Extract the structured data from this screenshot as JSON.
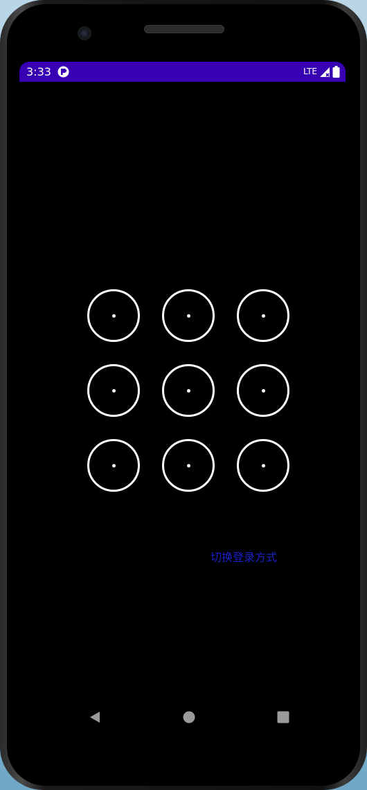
{
  "status_bar": {
    "time": "3:33",
    "network": "LTE",
    "notification_icon": "app-notification-icon",
    "signal_icon": "signal-icon",
    "battery_icon": "battery-icon",
    "background_color": "#3700b3"
  },
  "pattern_lock": {
    "rows": 3,
    "columns": 3,
    "node_color": "#ffffff",
    "nodes": [
      {
        "id": 1
      },
      {
        "id": 2
      },
      {
        "id": 3
      },
      {
        "id": 4
      },
      {
        "id": 5
      },
      {
        "id": 6
      },
      {
        "id": 7
      },
      {
        "id": 8
      },
      {
        "id": 9
      }
    ]
  },
  "actions": {
    "switch_login_label": "切换登录方式",
    "switch_login_color": "#1a22c8"
  },
  "navigation_bar": {
    "back_icon": "back-icon",
    "home_icon": "home-icon",
    "recents_icon": "recents-icon"
  },
  "screen": {
    "background_color": "#000000"
  }
}
